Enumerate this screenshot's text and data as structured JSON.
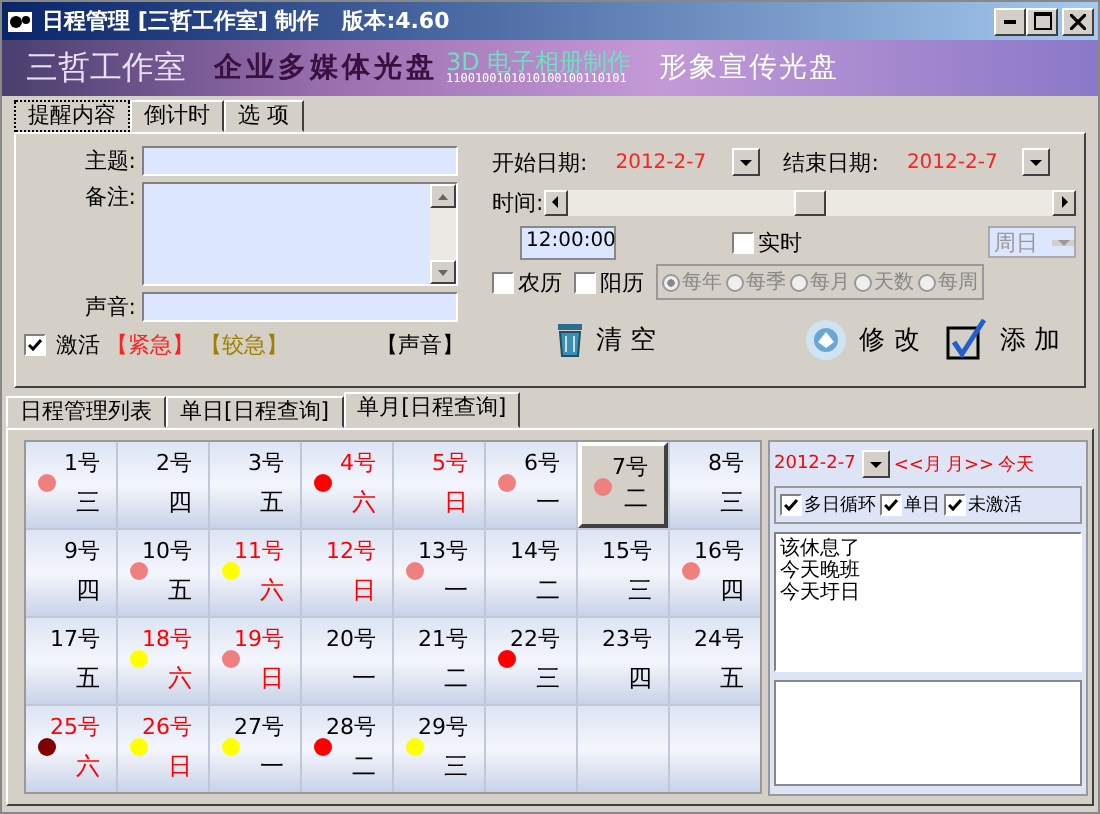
{
  "window": {
    "title": "日程管理 [三哲工作室] 制作   版本:4.60"
  },
  "banner": {
    "studio": "三哲工作室",
    "slogan_1": "企业多媒体光盘",
    "slogan_2": "3D 电子相册制作",
    "binary": "1100100101010100100110101",
    "slogan_3": "形象宣传光盘"
  },
  "tabs": [
    {
      "label": "提醒内容",
      "selected": true
    },
    {
      "label": "倒计时",
      "selected": false
    },
    {
      "label": "选 项",
      "selected": false
    }
  ],
  "form": {
    "subject_label": "主题:",
    "note_label": "备注:",
    "sound_label": "声音:",
    "activate": {
      "label": "激活",
      "checked": true
    },
    "tags": [
      {
        "label": "【紧急】",
        "color": "#ff2020"
      },
      {
        "label": "【较急】",
        "color": "#a08000"
      }
    ],
    "sound_tag": "【声音】",
    "start_label": "开始日期:",
    "start_date": "2012-2-7",
    "end_label": "结束日期:",
    "end_date": "2012-2-7",
    "time_label": "时间:",
    "time_slider": {
      "level": 0.5
    },
    "time_value": "12:00:00",
    "realtime": {
      "label": "实时",
      "checked": false
    },
    "weekday_select": "周日",
    "lunar": {
      "label": "农历",
      "checked": false
    },
    "solar": {
      "label": "阳历",
      "checked": false
    },
    "repeat": [
      {
        "label": "每年",
        "selected": true
      },
      {
        "label": "每季",
        "selected": false
      },
      {
        "label": "每月",
        "selected": false
      },
      {
        "label": "天数",
        "selected": false
      },
      {
        "label": "每周",
        "selected": false
      }
    ],
    "buttons": [
      {
        "kind": "clear",
        "label": "清 空"
      },
      {
        "kind": "edit",
        "label": "修 改"
      },
      {
        "kind": "add",
        "label": "添 加"
      }
    ]
  },
  "view_tabs": [
    {
      "label": "日程管理列表",
      "selected": false
    },
    {
      "label": "单日[日程查询]",
      "selected": false
    },
    {
      "label": "单月[日程查询]",
      "selected": true
    }
  ],
  "calendar": {
    "days": [
      {
        "day": "1号",
        "weekday": "三",
        "weekend": false,
        "color": "#f08080",
        "selected": false
      },
      {
        "day": "2号",
        "weekday": "四",
        "weekend": false,
        "selected": false
      },
      {
        "day": "3号",
        "weekday": "五",
        "weekend": false,
        "selected": false
      },
      {
        "day": "4号",
        "weekday": "六",
        "weekend": true,
        "color": "#ff0000",
        "selected": false
      },
      {
        "day": "5号",
        "weekday": "日",
        "weekend": true,
        "selected": false
      },
      {
        "day": "6号",
        "weekday": "一",
        "weekend": false,
        "color": "#f08080",
        "selected": false
      },
      {
        "day": "7号",
        "weekday": "二",
        "weekend": false,
        "color": "#f08080",
        "selected": true
      },
      {
        "day": "8号",
        "weekday": "三",
        "weekend": false,
        "selected": false
      },
      {
        "day": "9号",
        "weekday": "四",
        "weekend": false,
        "selected": false
      },
      {
        "day": "10号",
        "weekday": "五",
        "weekend": false,
        "color": "#f08080",
        "selected": false
      },
      {
        "day": "11号",
        "weekday": "六",
        "weekend": true,
        "color": "#ffff00",
        "selected": false
      },
      {
        "day": "12号",
        "weekday": "日",
        "weekend": true,
        "selected": false
      },
      {
        "day": "13号",
        "weekday": "一",
        "weekend": false,
        "color": "#f08080",
        "selected": false
      },
      {
        "day": "14号",
        "weekday": "二",
        "weekend": false,
        "selected": false
      },
      {
        "day": "15号",
        "weekday": "三",
        "weekend": false,
        "selected": false
      },
      {
        "day": "16号",
        "weekday": "四",
        "weekend": false,
        "color": "#f08080",
        "selected": false
      },
      {
        "day": "17号",
        "weekday": "五",
        "weekend": false,
        "selected": false
      },
      {
        "day": "18号",
        "weekday": "六",
        "weekend": true,
        "color": "#ffff00",
        "selected": false
      },
      {
        "day": "19号",
        "weekday": "日",
        "weekend": true,
        "color": "#f08080",
        "selected": false
      },
      {
        "day": "20号",
        "weekday": "一",
        "weekend": false,
        "selected": false
      },
      {
        "day": "21号",
        "weekday": "二",
        "weekend": false,
        "selected": false
      },
      {
        "day": "22号",
        "weekday": "三",
        "weekend": false,
        "color": "#ff0000",
        "selected": false
      },
      {
        "day": "23号",
        "weekday": "四",
        "weekend": false,
        "selected": false
      },
      {
        "day": "24号",
        "weekday": "五",
        "weekend": false,
        "selected": false
      },
      {
        "day": "25号",
        "weekday": "六",
        "weekend": true,
        "color": "#800000",
        "selected": false
      },
      {
        "day": "26号",
        "weekday": "日",
        "weekend": true,
        "color": "#ffff00",
        "selected": false
      },
      {
        "day": "27号",
        "weekday": "一",
        "weekend": false,
        "color": "#ffff00",
        "selected": false
      },
      {
        "day": "28号",
        "weekday": "二",
        "weekend": false,
        "color": "#ff0000",
        "selected": false
      },
      {
        "day": "29号",
        "weekday": "三",
        "weekend": false,
        "color": "#ffff00",
        "selected": false
      }
    ]
  },
  "side": {
    "date": "2012-2-7",
    "prev": "<<月",
    "next": "月>>",
    "today": "今天",
    "filters": [
      {
        "label": "多日循环",
        "checked": true
      },
      {
        "label": "单日",
        "checked": true
      },
      {
        "label": "未激活",
        "checked": true
      }
    ],
    "events": [
      "该休息了",
      "今天晚班",
      "今天圩日"
    ]
  }
}
